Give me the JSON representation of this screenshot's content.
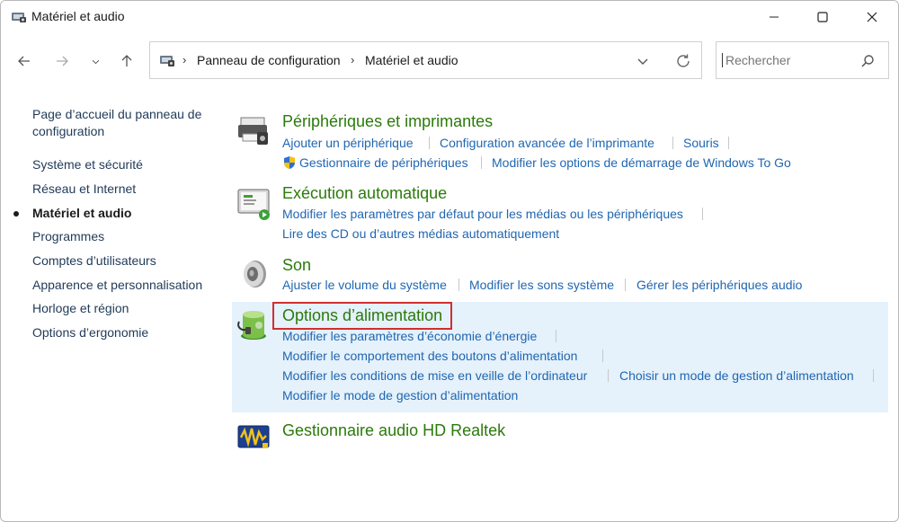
{
  "window": {
    "title": "Matériel et audio",
    "minimize_icon": "minimize-icon",
    "maximize_icon": "maximize-icon",
    "close_icon": "close-icon"
  },
  "address_bar": {
    "crumbs": [
      "Panneau de configuration",
      "Matériel et audio"
    ],
    "separator": "›"
  },
  "search": {
    "placeholder": "Rechercher"
  },
  "sidebar": {
    "items": [
      {
        "label": "Page d’accueil du panneau de",
        "label2": "configuration"
      },
      {
        "label": "Système et sécurité"
      },
      {
        "label": "Réseau et Internet"
      },
      {
        "label": "Matériel et audio",
        "active": true
      },
      {
        "label": "Programmes"
      },
      {
        "label": "Comptes d’utilisateurs"
      },
      {
        "label": "Apparence et personnalisation"
      },
      {
        "label": "Horloge et région"
      },
      {
        "label": "Options d’ergonomie"
      }
    ]
  },
  "categories": [
    {
      "title": "Périphériques et imprimantes",
      "icon": "printer-icon",
      "links": [
        "Ajouter un périphérique",
        "Configuration avancée de l’imprimante",
        "Souris",
        "Gestionnaire de périphériques",
        "Modifier les options de démarrage de Windows To Go"
      ]
    },
    {
      "title": "Exécution automatique",
      "icon": "autoplay-icon",
      "links": [
        "Modifier les paramètres par défaut pour les médias ou les périphériques",
        "Lire des CD ou d’autres médias automatiquement"
      ]
    },
    {
      "title": "Son",
      "icon": "speaker-icon",
      "links": [
        "Ajuster le volume du système",
        "Modifier les sons système",
        "Gérer les périphériques audio"
      ]
    },
    {
      "title": "Options d’alimentation",
      "icon": "power-options-icon",
      "links": [
        "Modifier les paramètres d’économie d’énergie",
        "Modifier le comportement des boutons d’alimentation",
        "Modifier les conditions de mise en veille de l’ordinateur",
        "Choisir un mode de gestion d’alimentation",
        "Modifier le mode de gestion d’alimentation"
      ]
    },
    {
      "title": "Gestionnaire audio HD Realtek",
      "icon": "realtek-audio-icon",
      "links": []
    }
  ],
  "colors": {
    "category_title": "#2b7a0b",
    "link": "#1f66b1",
    "highlight_bg": "#e5f1fb",
    "annotation_box": "#d12e2e"
  }
}
